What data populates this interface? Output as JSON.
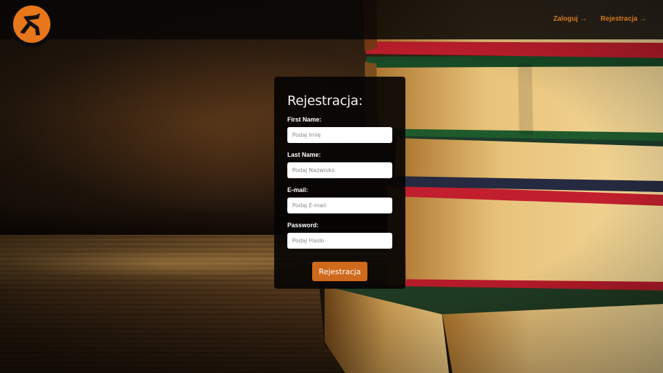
{
  "header": {
    "logo_icon": "logo-icon",
    "nav": [
      {
        "label": "Zaloguj",
        "arrow": "→"
      },
      {
        "label": "Rejestracja",
        "arrow": "→"
      }
    ]
  },
  "form": {
    "title": "Rejestracja:",
    "fields": [
      {
        "label": "First Name:",
        "placeholder": "Podaj Imię"
      },
      {
        "label": "Last Name:",
        "placeholder": "Podaj Nazwisko"
      },
      {
        "label": "E-mail:",
        "placeholder": "Podaj E-mail"
      },
      {
        "label": "Password:",
        "placeholder": "Podaj Hasło"
      }
    ],
    "submit_label": "Rejestracja"
  },
  "colors": {
    "accent": "#d6791f",
    "button": "#cf6a1c",
    "panel": "#040303"
  }
}
